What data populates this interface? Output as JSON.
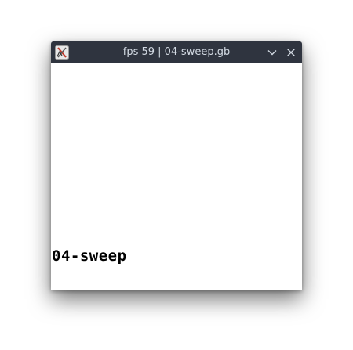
{
  "window": {
    "title": "fps 59 | 04-sweep.gb",
    "icons": {
      "app": "app-icon",
      "minimize": "chevron-down-icon",
      "close": "close-icon"
    },
    "colors": {
      "titlebar": "#2f343f",
      "title_text": "#d3dae3",
      "screen_bg": "#ffffff",
      "screen_text": "#000000"
    }
  },
  "screen": {
    "text": "04-sweep"
  }
}
